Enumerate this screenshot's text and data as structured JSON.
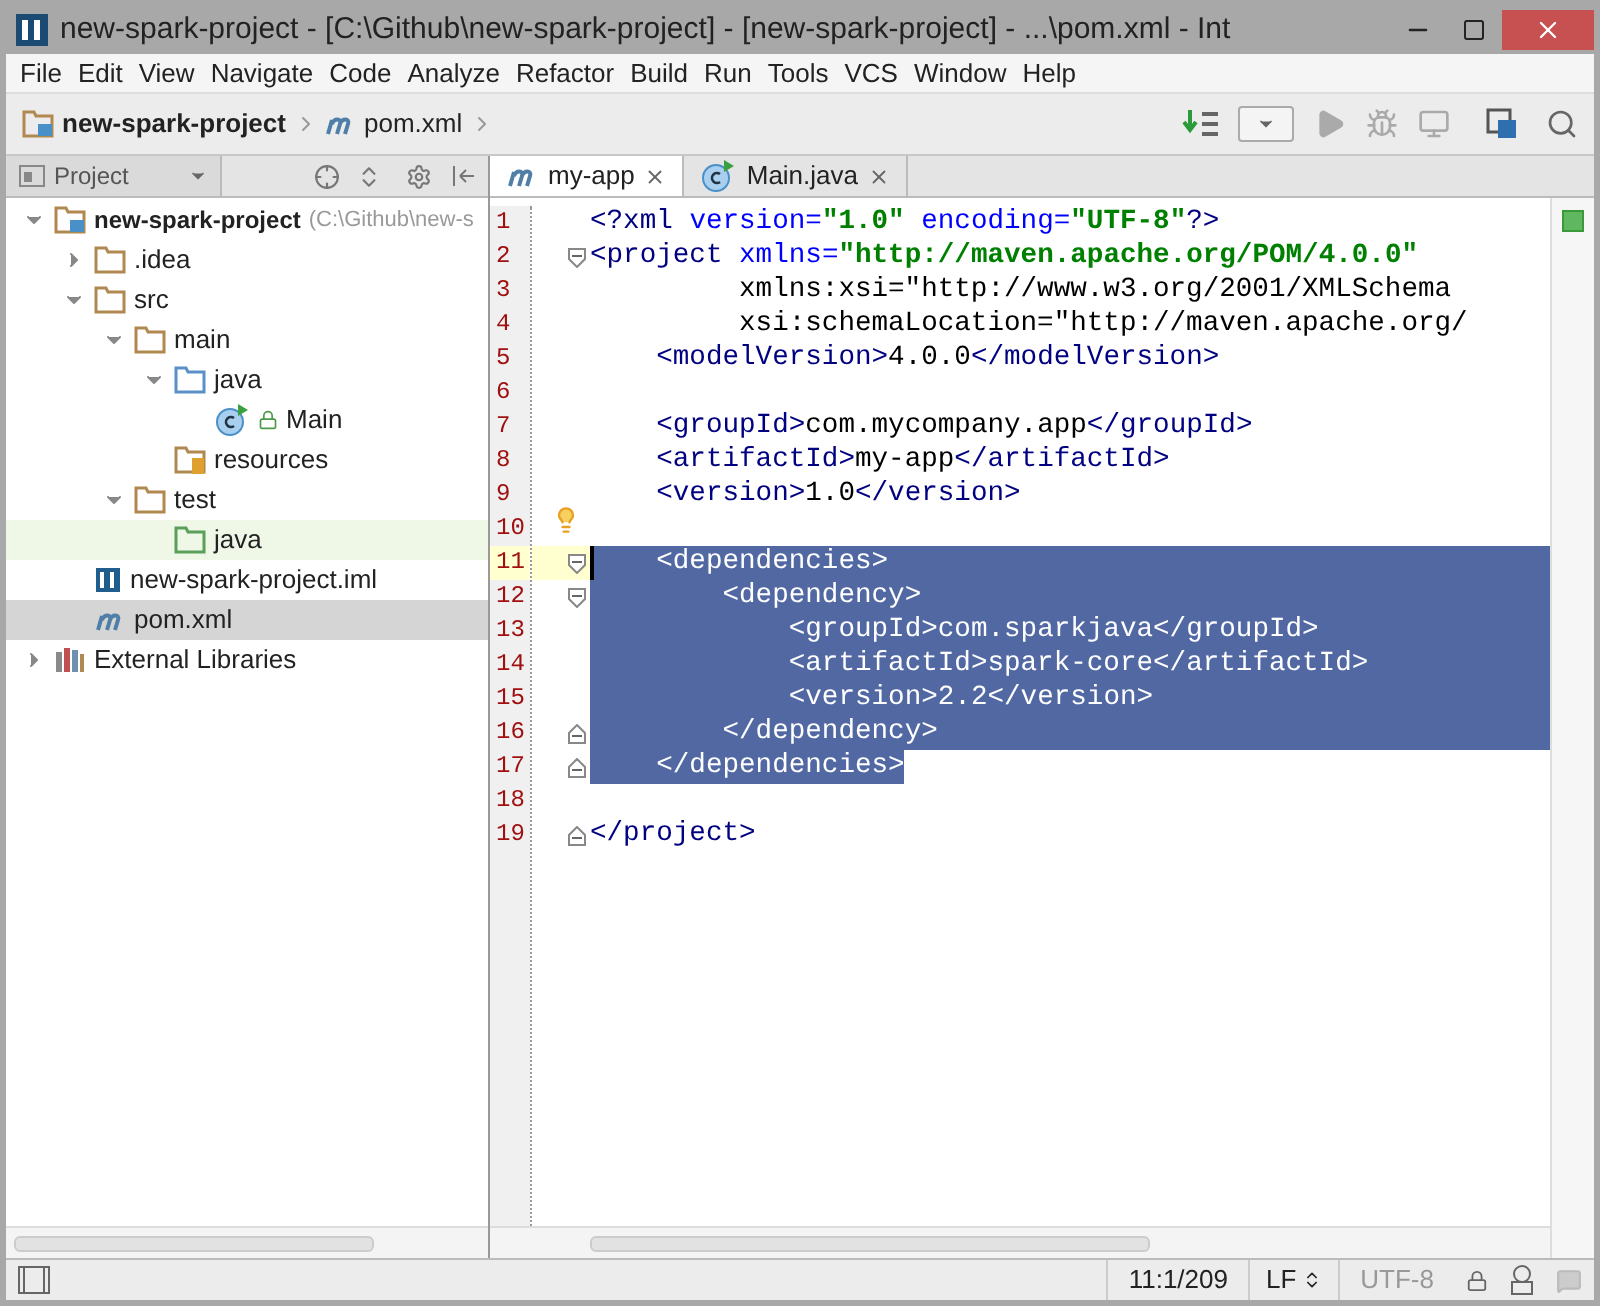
{
  "window": {
    "title": "new-spark-project - [C:\\Github\\new-spark-project] - [new-spark-project] - ...\\pom.xml - Int"
  },
  "menu": [
    "File",
    "Edit",
    "View",
    "Navigate",
    "Code",
    "Analyze",
    "Refactor",
    "Build",
    "Run",
    "Tools",
    "VCS",
    "Window",
    "Help"
  ],
  "breadcrumbs": [
    {
      "label": "new-spark-project",
      "kind": "project"
    },
    {
      "label": "pom.xml",
      "kind": "maven"
    }
  ],
  "project_panel": {
    "title": "Project"
  },
  "tree": [
    {
      "label": "new-spark-project",
      "path": "(C:\\Github\\new-s",
      "kind": "project",
      "expanded": true,
      "selected": false,
      "children": [
        {
          "label": ".idea",
          "kind": "folder",
          "expanded": false,
          "selected": false
        },
        {
          "label": "src",
          "kind": "folder",
          "expanded": true,
          "selected": false,
          "children": [
            {
              "label": "main",
              "kind": "folder",
              "expanded": true,
              "selected": false,
              "children": [
                {
                  "label": "java",
                  "kind": "source",
                  "expanded": true,
                  "selected": false,
                  "children": [
                    {
                      "label": "Main",
                      "kind": "class",
                      "selected": false
                    }
                  ]
                },
                {
                  "label": "resources",
                  "kind": "resources",
                  "selected": false
                }
              ]
            },
            {
              "label": "test",
              "kind": "folder",
              "expanded": true,
              "selected": false,
              "children": [
                {
                  "label": "java",
                  "kind": "test",
                  "selected": false,
                  "highlighted": true
                }
              ]
            }
          ]
        },
        {
          "label": "new-spark-project.iml",
          "kind": "iml",
          "selected": false
        },
        {
          "label": "pom.xml",
          "kind": "maven",
          "selected": true
        }
      ]
    },
    {
      "label": "External Libraries",
      "kind": "libraries",
      "expanded": false,
      "selected": false
    }
  ],
  "tabs": [
    {
      "label": "my-app",
      "kind": "maven",
      "selected": true
    },
    {
      "label": "Main.java",
      "kind": "class",
      "selected": false
    }
  ],
  "code": [
    {
      "n": "1",
      "text": "<?xml version=\"1.0\" encoding=\"UTF-8\"?>",
      "selected": false
    },
    {
      "n": "2",
      "text": "<project xmlns=\"http://maven.apache.org/POM/4.0.0\"",
      "selected": false,
      "fold_start": true
    },
    {
      "n": "3",
      "text": "         xmlns:xsi=\"http://www.w3.org/2001/XMLSchema",
      "selected": false
    },
    {
      "n": "4",
      "text": "         xsi:schemaLocation=\"http://maven.apache.org/",
      "selected": false
    },
    {
      "n": "5",
      "text": "    <modelVersion>4.0.0</modelVersion>",
      "selected": false
    },
    {
      "n": "6"
    },
    {
      "n": "7",
      "text": "    <groupId>com.mycompany.app</groupId>",
      "selected": false
    },
    {
      "n": "8",
      "text": "    <artifactId>my-app</artifactId>",
      "selected": false
    },
    {
      "n": "9",
      "text": "    <version>1.0</version>",
      "selected": false
    },
    {
      "n": "10",
      "hint": true
    },
    {
      "n": "11",
      "text": "    <dependencies>",
      "selected": true,
      "current": true,
      "fold_start": true
    },
    {
      "n": "12",
      "text": "        <dependency>",
      "selected": true,
      "fold_start": true
    },
    {
      "n": "13",
      "text": "            <groupId>com.sparkjava</groupId>",
      "selected": true
    },
    {
      "n": "14",
      "text": "            <artifactId>spark-core</artifactId>",
      "selected": true
    },
    {
      "n": "15",
      "text": "            <version>2.2</version>",
      "selected": true
    },
    {
      "n": "16",
      "text": "        </dependency>",
      "selected": true,
      "fold_end": true
    },
    {
      "n": "17",
      "text": "    </dependencies>",
      "selected": true,
      "fold_end": true
    },
    {
      "n": "18"
    },
    {
      "n": "19",
      "text": "</project>",
      "selected": false,
      "fold_end": true
    }
  ],
  "status_bar": {
    "position": "11:1/209",
    "line_separator": "LF",
    "encoding": "UTF-8",
    "encoding_disabled": true
  }
}
